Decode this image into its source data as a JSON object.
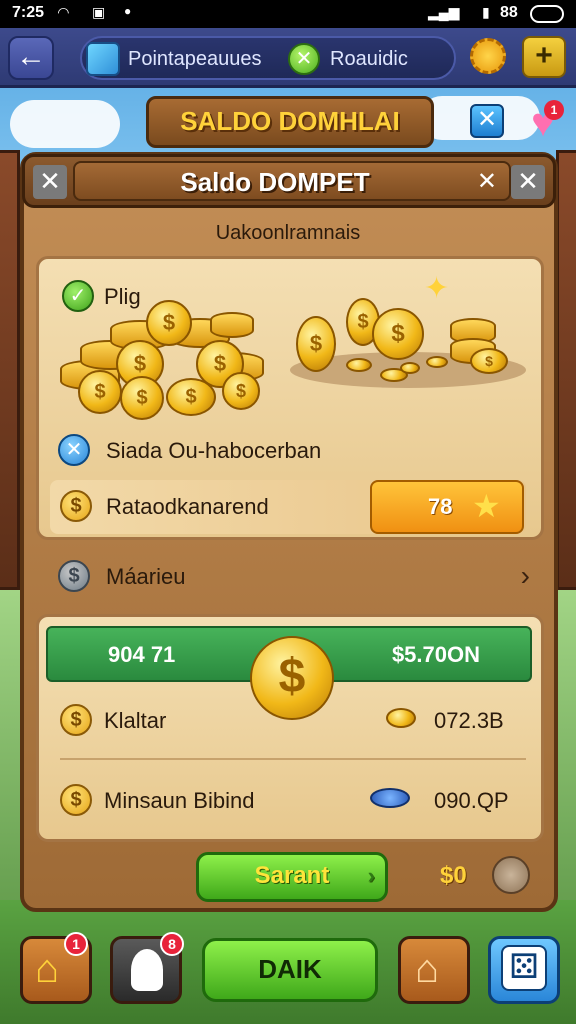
{
  "status_bar": {
    "time": "7:25",
    "right_text": "88"
  },
  "top_nav": {
    "pill_label_1": "Pointapeauues",
    "pill_label_2": "Roauidic",
    "plus_icon": "+",
    "back_icon": "←"
  },
  "banner": {
    "title": "SALDO DOMHLAI",
    "heart_badge": "1"
  },
  "wallet": {
    "title": "Saldo DOMPET",
    "subtitle": "Uakoonlramnais",
    "section1": {
      "row1_label": "Plig",
      "row2_label": "Siada Ou-habocerban",
      "row3_label": "Rataodkanarend",
      "row3_value": "78"
    },
    "mid_row_label": "Máarieu",
    "section2": {
      "green_left": "904 71",
      "green_right": "$5.70ON",
      "row1_label": "Klaltar",
      "row1_value": "072.3B",
      "row2_label": "Minsaun Bibind",
      "row2_value": "090.QP"
    },
    "action_button": "Sarant",
    "action_amount": "$0"
  },
  "dock": {
    "home_badge": "1",
    "profile_badge": "8",
    "main_button": "DAIK"
  },
  "colors": {
    "panel_wood": "#9e6a36",
    "parchment": "#f4dfb3",
    "accent_green": "#3fa81a",
    "accent_gold": "#f1b818",
    "nav_blue": "#2e3a74"
  }
}
